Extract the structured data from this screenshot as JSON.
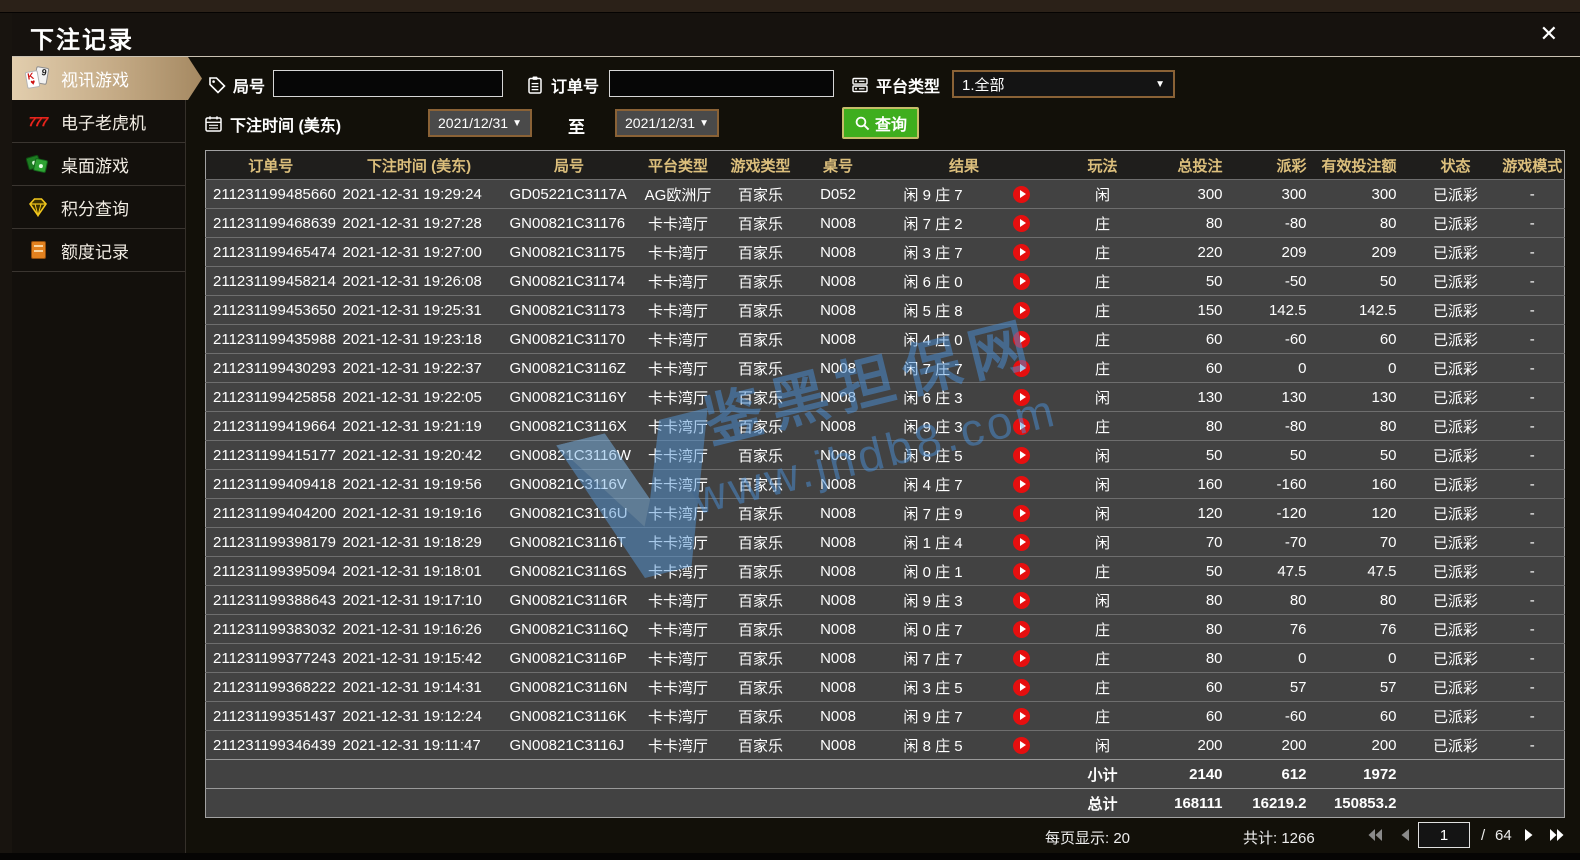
{
  "window": {
    "title": "下注记录",
    "close_glyph": "✕"
  },
  "sidebar": {
    "items": [
      {
        "label": "视讯游戏",
        "active": true
      },
      {
        "label": "电子老虎机",
        "active": false
      },
      {
        "label": "桌面游戏",
        "active": false
      },
      {
        "label": "积分查询",
        "active": false
      },
      {
        "label": "额度记录",
        "active": false
      }
    ],
    "card_back_glyph": "9",
    "card_front_glyph": "K",
    "card_suit_glyph": "♥",
    "slot_glyph": "777"
  },
  "filters": {
    "round_label": "局号",
    "round_value": "",
    "order_label": "订单号",
    "order_value": "",
    "platform_label": "平台类型",
    "platform_value": "1.全部",
    "bet_time_label": "下注时间 (美东)",
    "date_from": "2021/12/31",
    "to_label": "至",
    "date_to": "2021/12/31",
    "query_label": "查询",
    "caret_glyph": "▼"
  },
  "table": {
    "headers": [
      "订单号",
      "下注时间 (美东)",
      "局号",
      "平台类型",
      "游戏类型",
      "桌号",
      "结果",
      "玩法",
      "总投注",
      "派彩",
      "有效投注额",
      "状态",
      "游戏模式"
    ],
    "rows": [
      {
        "order": "211231199485660",
        "time": "2021-12-31 19:29:24",
        "round": "GD05221C3117A",
        "platform": "AG欧洲厅",
        "game": "百家乐",
        "tableno": "D052",
        "result": "闲 9 庄 7",
        "playtype": "闲",
        "total": "300",
        "payout": "300",
        "payout_class": "win",
        "valid": "300",
        "status": "已派彩",
        "mode": "-"
      },
      {
        "order": "211231199468639",
        "time": "2021-12-31 19:27:28",
        "round": "GN00821C31176",
        "platform": "卡卡湾厅",
        "game": "百家乐",
        "tableno": "N008",
        "result": "闲 7 庄 2",
        "playtype": "庄",
        "total": "80",
        "payout": "-80",
        "payout_class": "lose",
        "valid": "80",
        "status": "已派彩",
        "mode": "-"
      },
      {
        "order": "211231199465474",
        "time": "2021-12-31 19:27:00",
        "round": "GN00821C31175",
        "platform": "卡卡湾厅",
        "game": "百家乐",
        "tableno": "N008",
        "result": "闲 3 庄 7",
        "playtype": "庄",
        "total": "220",
        "payout": "209",
        "payout_class": "win",
        "valid": "209",
        "status": "已派彩",
        "mode": "-"
      },
      {
        "order": "211231199458214",
        "time": "2021-12-31 19:26:08",
        "round": "GN00821C31174",
        "platform": "卡卡湾厅",
        "game": "百家乐",
        "tableno": "N008",
        "result": "闲 6 庄 0",
        "playtype": "庄",
        "total": "50",
        "payout": "-50",
        "payout_class": "lose",
        "valid": "50",
        "status": "已派彩",
        "mode": "-"
      },
      {
        "order": "211231199453650",
        "time": "2021-12-31 19:25:31",
        "round": "GN00821C31173",
        "platform": "卡卡湾厅",
        "game": "百家乐",
        "tableno": "N008",
        "result": "闲 5 庄 8",
        "playtype": "庄",
        "total": "150",
        "payout": "142.5",
        "payout_class": "win",
        "valid": "142.5",
        "status": "已派彩",
        "mode": "-"
      },
      {
        "order": "211231199435988",
        "time": "2021-12-31 19:23:18",
        "round": "GN00821C31170",
        "platform": "卡卡湾厅",
        "game": "百家乐",
        "tableno": "N008",
        "result": "闲 4 庄 0",
        "playtype": "庄",
        "total": "60",
        "payout": "-60",
        "payout_class": "lose",
        "valid": "60",
        "status": "已派彩",
        "mode": "-"
      },
      {
        "order": "211231199430293",
        "time": "2021-12-31 19:22:37",
        "round": "GN00821C3116Z",
        "platform": "卡卡湾厅",
        "game": "百家乐",
        "tableno": "N008",
        "result": "闲 7 庄 7",
        "playtype": "庄",
        "total": "60",
        "payout": "0",
        "payout_class": "zero",
        "valid": "0",
        "status": "已派彩",
        "mode": "-"
      },
      {
        "order": "211231199425858",
        "time": "2021-12-31 19:22:05",
        "round": "GN00821C3116Y",
        "platform": "卡卡湾厅",
        "game": "百家乐",
        "tableno": "N008",
        "result": "闲 6 庄 3",
        "playtype": "闲",
        "total": "130",
        "payout": "130",
        "payout_class": "win",
        "valid": "130",
        "status": "已派彩",
        "mode": "-"
      },
      {
        "order": "211231199419664",
        "time": "2021-12-31 19:21:19",
        "round": "GN00821C3116X",
        "platform": "卡卡湾厅",
        "game": "百家乐",
        "tableno": "N008",
        "result": "闲 9 庄 3",
        "playtype": "庄",
        "total": "80",
        "payout": "-80",
        "payout_class": "lose",
        "valid": "80",
        "status": "已派彩",
        "mode": "-"
      },
      {
        "order": "211231199415177",
        "time": "2021-12-31 19:20:42",
        "round": "GN00821C3116W",
        "platform": "卡卡湾厅",
        "game": "百家乐",
        "tableno": "N008",
        "result": "闲 8 庄 5",
        "playtype": "闲",
        "total": "50",
        "payout": "50",
        "payout_class": "win",
        "valid": "50",
        "status": "已派彩",
        "mode": "-"
      },
      {
        "order": "211231199409418",
        "time": "2021-12-31 19:19:56",
        "round": "GN00821C3116V",
        "platform": "卡卡湾厅",
        "game": "百家乐",
        "tableno": "N008",
        "result": "闲 4 庄 7",
        "playtype": "闲",
        "total": "160",
        "payout": "-160",
        "payout_class": "lose",
        "valid": "160",
        "status": "已派彩",
        "mode": "-"
      },
      {
        "order": "211231199404200",
        "time": "2021-12-31 19:19:16",
        "round": "GN00821C3116U",
        "platform": "卡卡湾厅",
        "game": "百家乐",
        "tableno": "N008",
        "result": "闲 7 庄 9",
        "playtype": "闲",
        "total": "120",
        "payout": "-120",
        "payout_class": "lose",
        "valid": "120",
        "status": "已派彩",
        "mode": "-"
      },
      {
        "order": "211231199398179",
        "time": "2021-12-31 19:18:29",
        "round": "GN00821C3116T",
        "platform": "卡卡湾厅",
        "game": "百家乐",
        "tableno": "N008",
        "result": "闲 1 庄 4",
        "playtype": "闲",
        "total": "70",
        "payout": "-70",
        "payout_class": "lose",
        "valid": "70",
        "status": "已派彩",
        "mode": "-"
      },
      {
        "order": "211231199395094",
        "time": "2021-12-31 19:18:01",
        "round": "GN00821C3116S",
        "platform": "卡卡湾厅",
        "game": "百家乐",
        "tableno": "N008",
        "result": "闲 0 庄 1",
        "playtype": "庄",
        "total": "50",
        "payout": "47.5",
        "payout_class": "win",
        "valid": "47.5",
        "status": "已派彩",
        "mode": "-"
      },
      {
        "order": "211231199388643",
        "time": "2021-12-31 19:17:10",
        "round": "GN00821C3116R",
        "platform": "卡卡湾厅",
        "game": "百家乐",
        "tableno": "N008",
        "result": "闲 9 庄 3",
        "playtype": "闲",
        "total": "80",
        "payout": "80",
        "payout_class": "win",
        "valid": "80",
        "status": "已派彩",
        "mode": "-"
      },
      {
        "order": "211231199383032",
        "time": "2021-12-31 19:16:26",
        "round": "GN00821C3116Q",
        "platform": "卡卡湾厅",
        "game": "百家乐",
        "tableno": "N008",
        "result": "闲 0 庄 7",
        "playtype": "庄",
        "total": "80",
        "payout": "76",
        "payout_class": "win",
        "valid": "76",
        "status": "已派彩",
        "mode": "-"
      },
      {
        "order": "211231199377243",
        "time": "2021-12-31 19:15:42",
        "round": "GN00821C3116P",
        "platform": "卡卡湾厅",
        "game": "百家乐",
        "tableno": "N008",
        "result": "闲 7 庄 7",
        "playtype": "庄",
        "total": "80",
        "payout": "0",
        "payout_class": "zero",
        "valid": "0",
        "status": "已派彩",
        "mode": "-"
      },
      {
        "order": "211231199368222",
        "time": "2021-12-31 19:14:31",
        "round": "GN00821C3116N",
        "platform": "卡卡湾厅",
        "game": "百家乐",
        "tableno": "N008",
        "result": "闲 3 庄 5",
        "playtype": "庄",
        "total": "60",
        "payout": "57",
        "payout_class": "win",
        "valid": "57",
        "status": "已派彩",
        "mode": "-"
      },
      {
        "order": "211231199351437",
        "time": "2021-12-31 19:12:24",
        "round": "GN00821C3116K",
        "platform": "卡卡湾厅",
        "game": "百家乐",
        "tableno": "N008",
        "result": "闲 9 庄 7",
        "playtype": "庄",
        "total": "60",
        "payout": "-60",
        "payout_class": "lose",
        "valid": "60",
        "status": "已派彩",
        "mode": "-"
      },
      {
        "order": "211231199346439",
        "time": "2021-12-31 19:11:47",
        "round": "GN00821C3116J",
        "platform": "卡卡湾厅",
        "game": "百家乐",
        "tableno": "N008",
        "result": "闲 8 庄 5",
        "playtype": "闲",
        "total": "200",
        "payout": "200",
        "payout_class": "win",
        "valid": "200",
        "status": "已派彩",
        "mode": "-"
      }
    ],
    "subtotal": {
      "label": "小计",
      "total": "2140",
      "payout": "612",
      "valid": "1972"
    },
    "grand_total": {
      "label": "总计",
      "total": "168111",
      "payout": "16219.2",
      "valid": "150853.2"
    }
  },
  "watermark": {
    "line1": "鉴黑担保网",
    "line2": "www.jhdb8.com"
  },
  "footer": {
    "per_page": "每页显示: 20",
    "total_count": "共计: 1266",
    "page": "1",
    "page_sep": "/",
    "total_pages": "64"
  },
  "colors": {
    "accent_tan": "#c4aa85",
    "query_green": "#3fae1e",
    "status_green": "#18d418",
    "payout_win_red": "#d01515",
    "payout_lose_green": "#57de47",
    "summary_yellow": "#e8e800",
    "header_gold": "#dcbf7c"
  }
}
